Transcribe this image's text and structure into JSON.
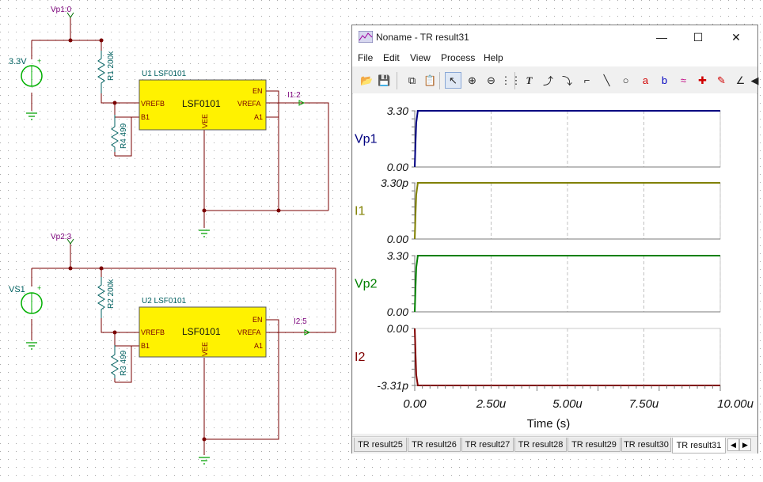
{
  "schematic": {
    "probes": {
      "vp1": "Vp1:0",
      "vp2": "Vp2:3",
      "i1": "I1:2",
      "i2": "I2:5"
    },
    "sources": {
      "vs_top": "3.3V",
      "vs_bottom": "VS1"
    },
    "resistors": {
      "r1": "R1 200k",
      "r4": "R4 499",
      "r2": "R2 200k",
      "r3": "R3 499"
    },
    "ics": [
      {
        "ref": "U1 LSF0101",
        "name": "LSF0101",
        "pins": {
          "vrefb": "VREFB",
          "b1": "B1",
          "en": "EN",
          "vrefa": "VREFA",
          "a1": "A1",
          "vee": "VEE"
        }
      },
      {
        "ref": "U2 LSF0101",
        "name": "LSF0101",
        "pins": {
          "vrefb": "VREFB",
          "b1": "B1",
          "en": "EN",
          "vrefa": "VREFA",
          "a1": "A1",
          "vee": "VEE"
        }
      }
    ],
    "plus_sign": "+"
  },
  "window": {
    "title": "Noname - TR result31",
    "minimize": "—",
    "maximize": "☐",
    "close": "✕",
    "menu": [
      "File",
      "Edit",
      "View",
      "Process",
      "Help"
    ],
    "toolbar": [
      {
        "name": "open-icon",
        "glyph": "📂"
      },
      {
        "name": "save-icon",
        "glyph": "💾"
      },
      {
        "name": "copy-icon",
        "glyph": "⧉"
      },
      {
        "name": "paste-icon",
        "glyph": "📋"
      },
      {
        "name": "pointer-icon",
        "glyph": "↖"
      },
      {
        "name": "zoom-in-icon",
        "glyph": "⊕"
      },
      {
        "name": "zoom-100-icon",
        "glyph": "⊖"
      },
      {
        "name": "grid-icon",
        "glyph": "⋮⋮"
      },
      {
        "name": "text-icon",
        "glyph": "T"
      },
      {
        "name": "curve-tool-icon",
        "glyph": "⤴"
      },
      {
        "name": "curve-tool-2-icon",
        "glyph": "⤵"
      },
      {
        "name": "step-tool-icon",
        "glyph": "⌐"
      },
      {
        "name": "line-icon",
        "glyph": "╲"
      },
      {
        "name": "circle-icon",
        "glyph": "○"
      },
      {
        "name": "cursor-a-icon",
        "glyph": "a"
      },
      {
        "name": "cursor-b-icon",
        "glyph": "b"
      },
      {
        "name": "wave-icon",
        "glyph": "≈"
      },
      {
        "name": "marker-icon",
        "glyph": "✚"
      },
      {
        "name": "probe-icon",
        "glyph": "✎"
      },
      {
        "name": "angle-icon",
        "glyph": "∠"
      },
      {
        "name": "scroll-left-icon",
        "glyph": "◀"
      }
    ],
    "tabs": [
      "TR result25",
      "TR result26",
      "TR result27",
      "TR result28",
      "TR result29",
      "TR result30",
      "TR result31"
    ],
    "active_tab": "TR result31",
    "tab_prev": "◀",
    "tab_next": "▶"
  },
  "colors": {
    "wire": "#7a0000",
    "ic_fill": "#fff200",
    "component": "#006060",
    "probe_label": "#7a007a",
    "source": "#00b000",
    "vp1": "#000080",
    "i1": "#808000",
    "vp2": "#008000",
    "i2": "#800000"
  },
  "chart_data": [
    {
      "type": "line",
      "name": "Vp1",
      "yticks": [
        "3.30",
        "0.00"
      ],
      "ylim": [
        0,
        3.3
      ],
      "series": [
        {
          "name": "Vp1",
          "x": [
            0,
            0.02,
            0.05,
            0.1,
            10
          ],
          "y": [
            0,
            1.2,
            2.6,
            3.3,
            3.3
          ]
        }
      ]
    },
    {
      "type": "line",
      "name": "I1",
      "yticks": [
        "3.30p",
        "0.00"
      ],
      "ylim": [
        0,
        3.3
      ],
      "series": [
        {
          "name": "I1",
          "x": [
            0,
            0.02,
            0.05,
            0.1,
            10
          ],
          "y": [
            0,
            1.2,
            2.6,
            3.3,
            3.3
          ]
        }
      ]
    },
    {
      "type": "line",
      "name": "Vp2",
      "yticks": [
        "3.30",
        "0.00"
      ],
      "ylim": [
        0,
        3.3
      ],
      "series": [
        {
          "name": "Vp2",
          "x": [
            0,
            0.02,
            0.05,
            0.1,
            10
          ],
          "y": [
            0,
            1.2,
            2.6,
            3.3,
            3.3
          ]
        }
      ]
    },
    {
      "type": "line",
      "name": "I2",
      "yticks": [
        "0.00",
        "-3.31p"
      ],
      "ylim": [
        -3.31,
        0
      ],
      "series": [
        {
          "name": "I2",
          "x": [
            0,
            0.02,
            0.05,
            0.1,
            10
          ],
          "y": [
            0,
            -1.2,
            -2.7,
            -3.31,
            -3.31
          ]
        }
      ]
    }
  ],
  "xaxis": {
    "ticks": [
      "0.00",
      "2.50u",
      "5.00u",
      "7.50u",
      "10.00u"
    ],
    "tick_values": [
      0,
      2.5,
      5,
      7.5,
      10
    ],
    "label": "Time (s)",
    "xlim": [
      0,
      10
    ]
  }
}
